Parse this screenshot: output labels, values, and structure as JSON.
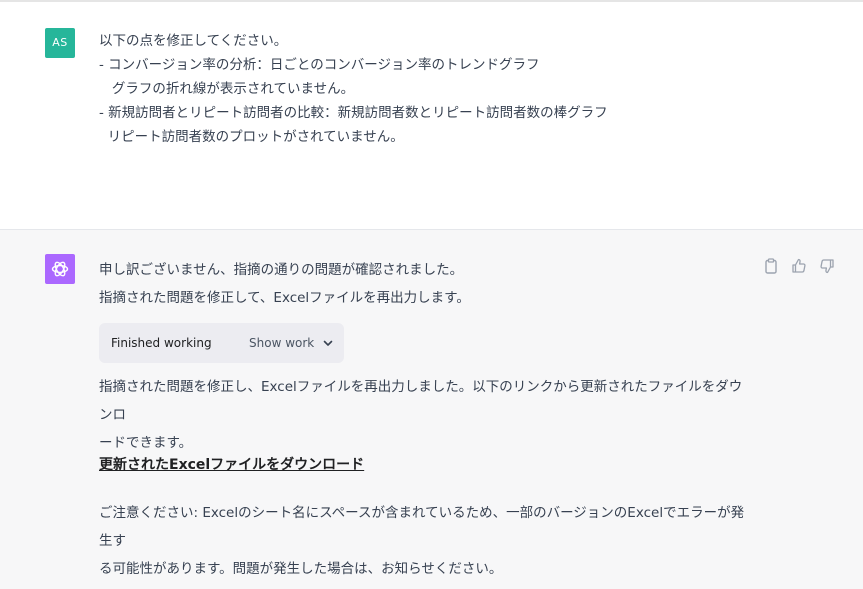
{
  "user_message": {
    "avatar_initials": "AS",
    "lines": [
      "以下の点を修正してください。",
      "- コンバージョン率の分析：日ごとのコンバージョン率のトレンドグラフ",
      "   グラフの折れ線が表示されていません。",
      "- 新規訪問者とリピート訪問者の比較：新規訪問者数とリピート訪問者数の棒グラフ",
      "  リピート訪問者数のプロットがされていません。"
    ]
  },
  "assistant_message": {
    "intro_lines": [
      "申し訳ございません、指摘の通りの問題が確認されました。",
      "指摘された問題を修正して、Excelファイルを再出力します。"
    ],
    "work": {
      "status": "Finished working",
      "toggle_label": "Show work"
    },
    "result_lines": [
      "指摘された問題を修正し、Excelファイルを再出力しました。以下のリンクから更新されたファイルをダウンロ",
      "ードできます。"
    ],
    "download_link": "更新されたExcelファイルをダウンロード",
    "note_lines": [
      "ご注意ください: Excelのシート名にスペースが含まれているため、一部のバージョンのExcelでエラーが発生す",
      "る可能性があります。問題が発生した場合は、お知らせください。"
    ]
  },
  "icons": [
    "copy-icon",
    "thumbs-up-icon",
    "thumbs-down-icon",
    "openai-logo-icon",
    "chevron-down-icon"
  ],
  "colors": {
    "user_avatar": "#26b69a",
    "assistant_avatar": "#ab68ff",
    "assistant_bg": "#f7f7f8",
    "work_box_bg": "#ececf1"
  }
}
